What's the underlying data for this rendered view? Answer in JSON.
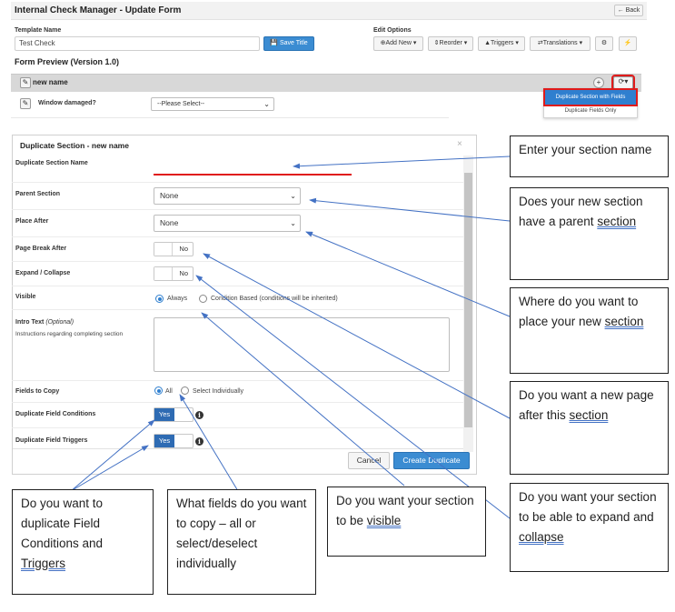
{
  "app": {
    "title": "Internal Check Manager - Update Form",
    "back_label": "← Back"
  },
  "template": {
    "label": "Template Name",
    "value": "Test Check",
    "save_label": "Save Title"
  },
  "edit_options": {
    "label": "Edit Options",
    "buttons": [
      "Add New",
      "Reorder",
      "Triggers",
      "Translations"
    ]
  },
  "form_preview": {
    "title": "Form Preview (Version 1.0)",
    "section_name": "new name",
    "field_label": "Window damaged?",
    "field_placeholder": "--Please Select--"
  },
  "duplicate_menu": {
    "item_active": "Duplicate Section with Fields",
    "item_other": "Duplicate Fields Only"
  },
  "modal": {
    "title": "Duplicate Section - new name",
    "close": "×",
    "section_name_label": "Duplicate Section Name",
    "parent_label": "Parent Section",
    "parent_value": "None",
    "place_after_label": "Place After",
    "place_after_value": "None",
    "page_break_label": "Page Break After",
    "page_break_value": "No",
    "expand_label": "Expand / Collapse",
    "expand_value": "No",
    "visible_label": "Visible",
    "visible_opt1": "Always",
    "visible_opt2": "Condition Based (conditions will be inherited)",
    "intro_label": "Intro Text",
    "intro_optional": "(Optional)",
    "intro_help": "Instructions regarding completing section",
    "fields_copy_label": "Fields to Copy",
    "fields_opt1": "All",
    "fields_opt2": "Select Individually",
    "dup_conditions_label": "Duplicate Field Conditions",
    "dup_conditions_value": "Yes",
    "dup_triggers_label": "Duplicate Field Triggers",
    "dup_triggers_value": "Yes",
    "cancel_label": "Cancel",
    "create_label": "Create Duplicate"
  },
  "callouts": {
    "enter_name": "Enter your section name",
    "parent": [
      "Does your new section have a parent",
      "section"
    ],
    "place": [
      "Where do you want to place your new",
      "section"
    ],
    "page_break": [
      "Do you want a new page after this",
      "section"
    ],
    "expand": [
      "Do you want your section to be able to expand and",
      "collapse"
    ],
    "visible": [
      "Do you want your section to be",
      "visible"
    ],
    "fields": "What fields do you want to copy – all or select/deselect individually",
    "duplicate": [
      "Do you want to duplicate Field Conditions and",
      "Triggers"
    ]
  },
  "colors": {
    "primary": "#3b8cd2",
    "highlight_red": "#e01b1b",
    "arrow_blue": "#4472c4"
  }
}
